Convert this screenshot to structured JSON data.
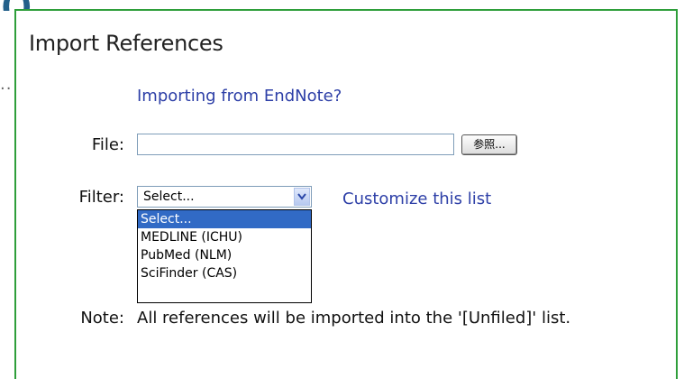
{
  "background": {
    "partial_mark": "()"
  },
  "panel": {
    "title": "Import References",
    "endnote_link": "Importing from EndNote?",
    "file_label": "File:",
    "file_value": "",
    "browse_button": "参照...",
    "filter_label": "Filter:",
    "filter_selected": "Select...",
    "customize_link": "Customize this list",
    "note_label": "Note:",
    "note_text": "All references will be imported into the '[Unfiled]' list.",
    "filter_options": [
      "Select...",
      "MEDLINE (ICHU)",
      "PubMed (NLM)",
      "SciFinder (CAS)"
    ]
  },
  "colors": {
    "panel_border": "#2e9e3a",
    "link": "#2d3fa7",
    "selected_option": "#316ac5"
  }
}
